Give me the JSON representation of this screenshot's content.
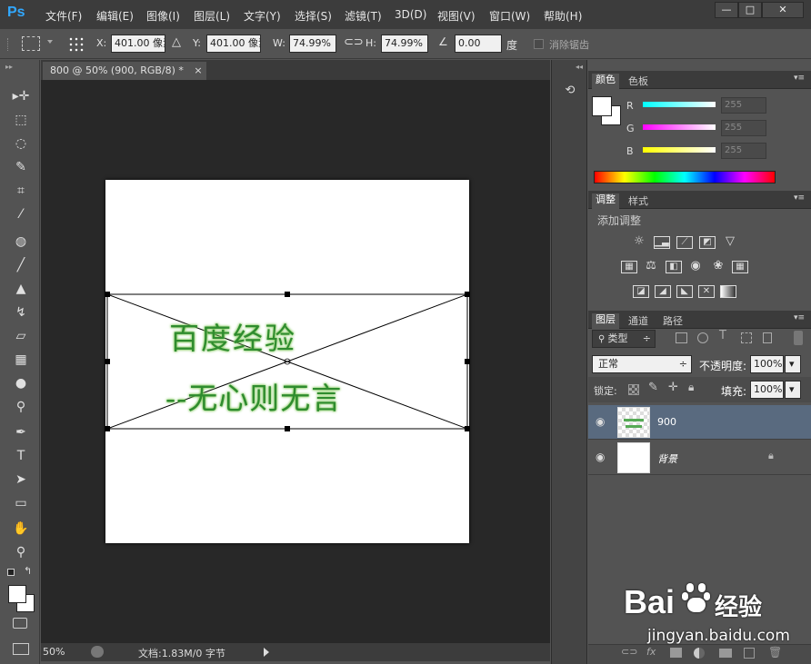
{
  "app": {
    "logo": "Ps"
  },
  "menu": [
    "文件(F)",
    "编辑(E)",
    "图像(I)",
    "图层(L)",
    "文字(Y)",
    "选择(S)",
    "滤镜(T)",
    "3D(D)",
    "视图(V)",
    "窗口(W)",
    "帮助(H)"
  ],
  "window_controls": {
    "minimize": "—",
    "maximize": "□",
    "close": "✕"
  },
  "options": {
    "x_label": "X:",
    "x_value": "401.00 像素",
    "y_label": "Y:",
    "y_value": "401.00 像素",
    "w_label": "W:",
    "w_value": "74.99%",
    "h_label": "H:",
    "h_value": "74.99%",
    "angle_value": "0.00",
    "angle_unit": "度",
    "antialias_label": "消除锯齿"
  },
  "document": {
    "tab_title": "800 @ 50% (900, RGB/8) *",
    "tab_close": "×",
    "line1": "百度经验",
    "line2": "--无心则无言"
  },
  "status": {
    "zoom": "50%",
    "doc_info": "文档:1.83M/0 字节"
  },
  "color_panel": {
    "tabs": [
      "颜色",
      "色板"
    ],
    "channels": [
      {
        "label": "R",
        "value": "255"
      },
      {
        "label": "G",
        "value": "255"
      },
      {
        "label": "B",
        "value": "255"
      }
    ]
  },
  "adjust_panel": {
    "tabs": [
      "调整",
      "样式"
    ],
    "title": "添加调整"
  },
  "layers_panel": {
    "tabs": [
      "图层",
      "通道",
      "路径"
    ],
    "filter_label": "类型",
    "blend_mode": "正常",
    "opacity_label": "不透明度:",
    "opacity_value": "100%",
    "lock_label": "锁定:",
    "fill_label": "填充:",
    "fill_value": "100%",
    "layers": [
      {
        "name": "900"
      },
      {
        "name": "背景"
      }
    ]
  },
  "watermark": {
    "brand": "Bai",
    "brand2": "经验",
    "url": "jingyan.baidu.com"
  },
  "colors": {
    "accent": "#31a8ff",
    "text_green": "#2f8c2f",
    "selected_layer": "#596a7f"
  }
}
